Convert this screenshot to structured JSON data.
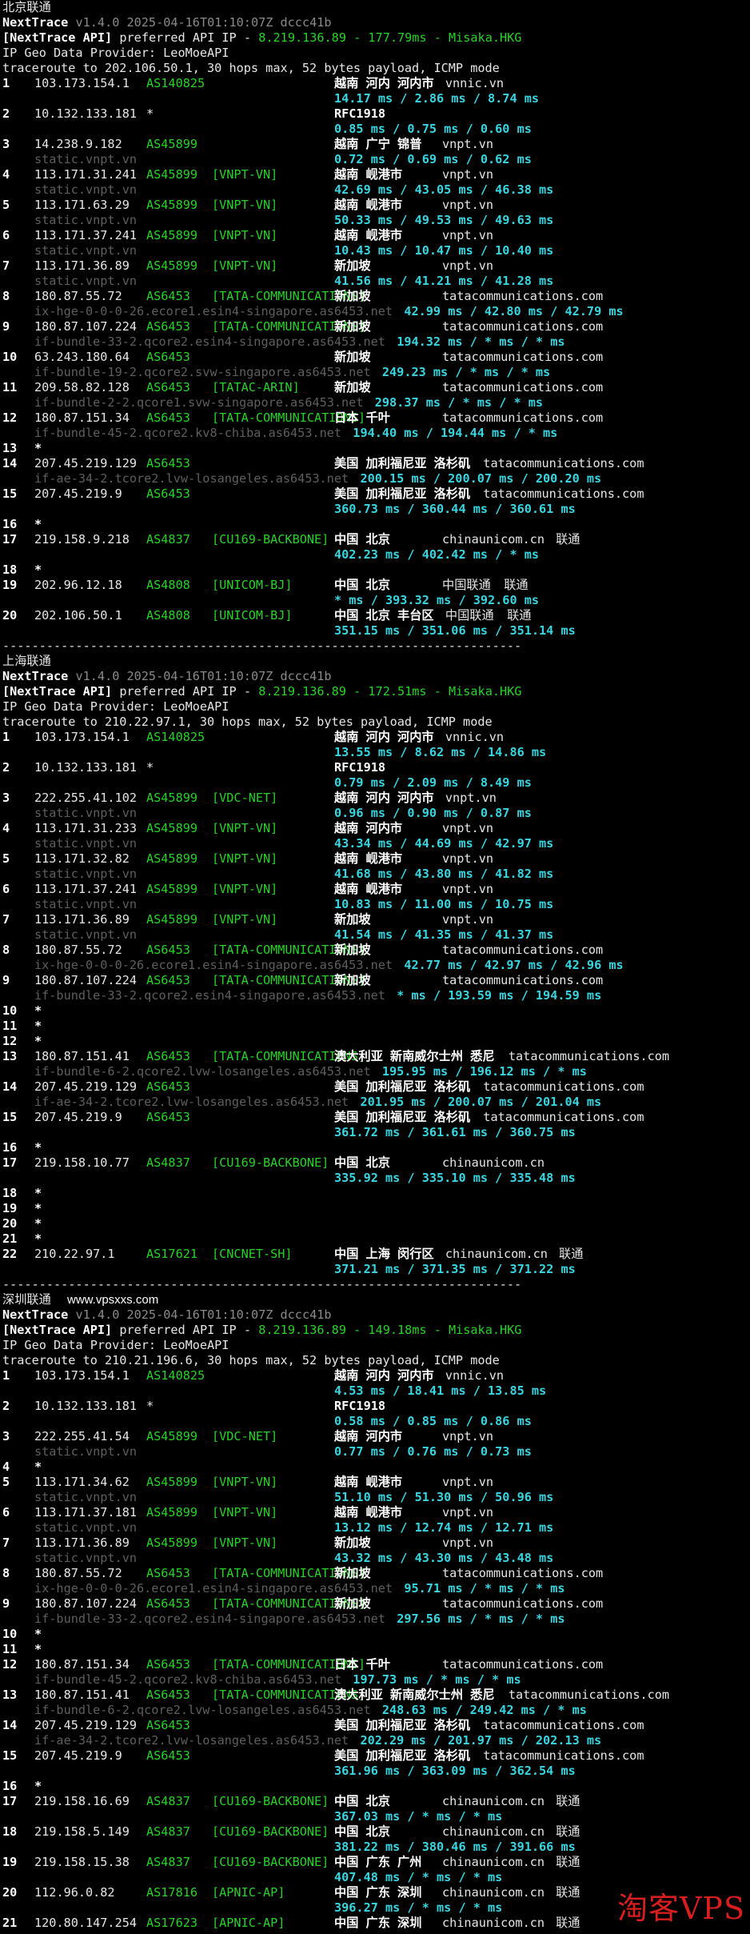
{
  "watermark": "淘客VPS",
  "site_mark": "www.vpsxxs.com",
  "lines": [
    [
      [
        "c-plain",
        "北京联通"
      ]
    ],
    [
      [
        "c-white",
        "NextTrace "
      ],
      [
        "c-gray",
        "v1.4.0 2025-04-16T01:10:07Z dccc41b"
      ]
    ],
    [
      [
        "c-white",
        "[NextTrace API] "
      ],
      [
        "c-plain",
        "preferred API IP - "
      ],
      [
        "c-green",
        "8.219.136.89 - 177.79ms - Misaka.HKG"
      ]
    ],
    [
      [
        "c-plain",
        "IP Geo Data Provider: LeoMoeAPI"
      ]
    ],
    [
      [
        "c-plain",
        "traceroute to 202.106.50.1, 30 hops max, 52 bytes payload, ICMP mode"
      ]
    ],
    {
      "hop": "1",
      "ip": "103.173.154.1",
      "asn": "AS140825",
      "tag": "",
      "geo": "越南 河内 河内市",
      "dom": "vnnic.vn",
      "carrier": ""
    },
    {
      "ms": "14.17 ms / 2.86 ms / 8.74 ms"
    },
    {
      "hop": "2",
      "ip": "10.132.133.181",
      "asn": "*",
      "tag": "",
      "geo": "RFC1918",
      "dom": "",
      "carrier": ""
    },
    {
      "ms": "0.85 ms / 0.75 ms / 0.60 ms"
    },
    {
      "hop": "3",
      "ip": "14.238.9.182",
      "asn": "AS45899",
      "tag": "",
      "geo": "越南 广宁 锦普",
      "dom": "vnpt.vn",
      "carrier": ""
    },
    {
      "rdns": "static.vnpt.vn",
      "ms": "0.72 ms / 0.69 ms / 0.62 ms"
    },
    {
      "hop": "4",
      "ip": "113.171.31.241",
      "asn": "AS45899",
      "tag": "[VNPT-VN]",
      "geo": "越南 岘港市",
      "dom": "vnpt.vn",
      "carrier": ""
    },
    {
      "rdns": "static.vnpt.vn",
      "ms": "42.69 ms / 43.05 ms / 46.38 ms"
    },
    {
      "hop": "5",
      "ip": "113.171.63.29",
      "asn": "AS45899",
      "tag": "[VNPT-VN]",
      "geo": "越南 岘港市",
      "dom": "vnpt.vn",
      "carrier": ""
    },
    {
      "rdns": "static.vnpt.vn",
      "ms": "50.33 ms / 49.53 ms / 49.63 ms"
    },
    {
      "hop": "6",
      "ip": "113.171.37.241",
      "asn": "AS45899",
      "tag": "[VNPT-VN]",
      "geo": "越南 岘港市",
      "dom": "vnpt.vn",
      "carrier": ""
    },
    {
      "rdns": "static.vnpt.vn",
      "ms": "10.43 ms / 10.47 ms / 10.40 ms"
    },
    {
      "hop": "7",
      "ip": "113.171.36.89",
      "asn": "AS45899",
      "tag": "[VNPT-VN]",
      "geo": "新加坡",
      "dom": "vnpt.vn",
      "carrier": ""
    },
    {
      "rdns": "static.vnpt.vn",
      "ms": "41.56 ms / 41.21 ms / 41.28 ms"
    },
    {
      "hop": "8",
      "ip": "180.87.55.72",
      "asn": "AS6453",
      "tag": "[TATA-COMMUNICATIONS]",
      "geo": "新加坡",
      "dom": "tatacommunications.com",
      "carrier": ""
    },
    {
      "rdns": "ix-hge-0-0-0-26.ecore1.esin4-singapore.as6453.net",
      "ms": "42.99 ms / 42.80 ms / 42.79 ms",
      "inline": true
    },
    {
      "hop": "9",
      "ip": "180.87.107.224",
      "asn": "AS6453",
      "tag": "[TATA-COMMUNICATIONS]",
      "geo": "新加坡",
      "dom": "tatacommunications.com",
      "carrier": ""
    },
    {
      "rdns": "if-bundle-33-2.qcore2.esin4-singapore.as6453.net",
      "ms": "194.32 ms / * ms / * ms",
      "inline": true
    },
    {
      "hop": "10",
      "ip": "63.243.180.64",
      "asn": "AS6453",
      "tag": "",
      "geo": "新加坡",
      "dom": "tatacommunications.com",
      "carrier": ""
    },
    {
      "rdns": "if-bundle-19-2.qcore2.svw-singapore.as6453.net",
      "ms": "249.23 ms / * ms / * ms",
      "inline": true
    },
    {
      "hop": "11",
      "ip": "209.58.82.128",
      "asn": "AS6453",
      "tag": "[TATAC-ARIN]",
      "geo": "新加坡",
      "dom": "tatacommunications.com",
      "carrier": ""
    },
    {
      "rdns": "if-bundle-2-2.qcore1.svw-singapore.as6453.net",
      "ms": "298.37 ms / * ms / * ms",
      "inline": true
    },
    {
      "hop": "12",
      "ip": "180.87.151.34",
      "asn": "AS6453",
      "tag": "[TATA-COMMUNICATIONS]",
      "geo": "日本 千叶",
      "dom": "tatacommunications.com",
      "carrier": ""
    },
    {
      "rdns": "if-bundle-45-2.qcore2.kv8-chiba.as6453.net",
      "ms": "194.40 ms / 194.44 ms / * ms",
      "inline": true
    },
    {
      "star": "13"
    },
    {
      "hop": "14",
      "ip": "207.45.219.129",
      "asn": "AS6453",
      "tag": "",
      "geo": "美国 加利福尼亚 洛杉矶",
      "dom": "tatacommunications.com",
      "carrier": ""
    },
    {
      "rdns": "if-ae-34-2.tcore2.lvw-losangeles.as6453.net",
      "ms": "200.15 ms / 200.07 ms / 200.20 ms",
      "inline": true
    },
    {
      "hop": "15",
      "ip": "207.45.219.9",
      "asn": "AS6453",
      "tag": "",
      "geo": "美国 加利福尼亚 洛杉矶",
      "dom": "tatacommunications.com",
      "carrier": ""
    },
    {
      "ms": "360.73 ms / 360.44 ms / 360.61 ms"
    },
    {
      "star": "16"
    },
    {
      "hop": "17",
      "ip": "219.158.9.218",
      "asn": "AS4837",
      "tag": "[CU169-BACKBONE]",
      "geo": "中国 北京",
      "dom": "chinaunicom.cn",
      "carrier": "联通"
    },
    {
      "ms": "402.23 ms / 402.42 ms / * ms"
    },
    {
      "star": "18"
    },
    {
      "hop": "19",
      "ip": "202.96.12.18",
      "asn": "AS4808",
      "tag": "[UNICOM-BJ]",
      "geo": "中国 北京",
      "dom": "中国联通",
      "carrier": "联通"
    },
    {
      "ms": "* ms / 393.32 ms / 392.60 ms"
    },
    {
      "hop": "20",
      "ip": "202.106.50.1",
      "asn": "AS4808",
      "tag": "[UNICOM-BJ]",
      "geo": "中国 北京 丰台区",
      "dom": "中国联通",
      "carrier": "联通"
    },
    {
      "ms": "351.15 ms / 351.06 ms / 351.14 ms"
    },
    [
      [
        "c-plain",
        "-----------------------------------------------------------------------"
      ]
    ],
    [
      [
        "c-plain",
        "上海联通"
      ]
    ],
    [
      [
        "c-white",
        "NextTrace "
      ],
      [
        "c-gray",
        "v1.4.0 2025-04-16T01:10:07Z dccc41b"
      ]
    ],
    [
      [
        "c-white",
        "[NextTrace API] "
      ],
      [
        "c-plain",
        "preferred API IP - "
      ],
      [
        "c-green",
        "8.219.136.89 - 172.51ms - Misaka.HKG"
      ]
    ],
    [
      [
        "c-plain",
        "IP Geo Data Provider: LeoMoeAPI"
      ]
    ],
    [
      [
        "c-plain",
        "traceroute to 210.22.97.1, 30 hops max, 52 bytes payload, ICMP mode"
      ]
    ],
    {
      "hop": "1",
      "ip": "103.173.154.1",
      "asn": "AS140825",
      "tag": "",
      "geo": "越南 河内 河内市",
      "dom": "vnnic.vn",
      "carrier": ""
    },
    {
      "ms": "13.55 ms / 8.62 ms / 14.86 ms"
    },
    {
      "hop": "2",
      "ip": "10.132.133.181",
      "asn": "*",
      "tag": "",
      "geo": "RFC1918",
      "dom": "",
      "carrier": ""
    },
    {
      "ms": "0.79 ms / 2.09 ms / 8.49 ms"
    },
    {
      "hop": "3",
      "ip": "222.255.41.102",
      "asn": "AS45899",
      "tag": "[VDC-NET]",
      "geo": "越南 河内 河内市",
      "dom": "vnpt.vn",
      "carrier": ""
    },
    {
      "rdns": "static.vnpt.vn",
      "ms": "0.96 ms / 0.90 ms / 0.87 ms"
    },
    {
      "hop": "4",
      "ip": "113.171.31.233",
      "asn": "AS45899",
      "tag": "[VNPT-VN]",
      "geo": "越南 河内市",
      "dom": "vnpt.vn",
      "carrier": ""
    },
    {
      "rdns": "static.vnpt.vn",
      "ms": "43.34 ms / 44.69 ms / 42.97 ms"
    },
    {
      "hop": "5",
      "ip": "113.171.32.82",
      "asn": "AS45899",
      "tag": "[VNPT-VN]",
      "geo": "越南 岘港市",
      "dom": "vnpt.vn",
      "carrier": ""
    },
    {
      "rdns": "static.vnpt.vn",
      "ms": "41.68 ms / 43.80 ms / 41.82 ms"
    },
    {
      "hop": "6",
      "ip": "113.171.37.241",
      "asn": "AS45899",
      "tag": "[VNPT-VN]",
      "geo": "越南 岘港市",
      "dom": "vnpt.vn",
      "carrier": ""
    },
    {
      "rdns": "static.vnpt.vn",
      "ms": "10.83 ms / 11.00 ms / 10.75 ms"
    },
    {
      "hop": "7",
      "ip": "113.171.36.89",
      "asn": "AS45899",
      "tag": "[VNPT-VN]",
      "geo": "新加坡",
      "dom": "vnpt.vn",
      "carrier": ""
    },
    {
      "rdns": "static.vnpt.vn",
      "ms": "41.54 ms / 41.35 ms / 41.37 ms"
    },
    {
      "hop": "8",
      "ip": "180.87.55.72",
      "asn": "AS6453",
      "tag": "[TATA-COMMUNICATIONS]",
      "geo": "新加坡",
      "dom": "tatacommunications.com",
      "carrier": ""
    },
    {
      "rdns": "ix-hge-0-0-0-26.ecore1.esin4-singapore.as6453.net",
      "ms": "42.77 ms / 42.97 ms / 42.96 ms",
      "inline": true
    },
    {
      "hop": "9",
      "ip": "180.87.107.224",
      "asn": "AS6453",
      "tag": "[TATA-COMMUNICATIONS]",
      "geo": "新加坡",
      "dom": "tatacommunications.com",
      "carrier": ""
    },
    {
      "rdns": "if-bundle-33-2.qcore2.esin4-singapore.as6453.net",
      "ms": "* ms / 193.59 ms / 194.59 ms",
      "inline": true
    },
    {
      "star": "10"
    },
    {
      "star": "11"
    },
    {
      "star": "12"
    },
    {
      "hop": "13",
      "ip": "180.87.151.41",
      "asn": "AS6453",
      "tag": "[TATA-COMMUNICATIONS]",
      "geo": "澳大利亚 新南威尔士州 悉尼",
      "dom": "tatacommunications.com",
      "carrier": ""
    },
    {
      "rdns": "if-bundle-6-2.qcore2.lvw-losangeles.as6453.net",
      "ms": "195.95 ms / 196.12 ms / * ms",
      "inline": true
    },
    {
      "hop": "14",
      "ip": "207.45.219.129",
      "asn": "AS6453",
      "tag": "",
      "geo": "美国 加利福尼亚 洛杉矶",
      "dom": "tatacommunications.com",
      "carrier": ""
    },
    {
      "rdns": "if-ae-34-2.tcore2.lvw-losangeles.as6453.net",
      "ms": "201.95 ms / 200.07 ms / 201.04 ms",
      "inline": true
    },
    {
      "hop": "15",
      "ip": "207.45.219.9",
      "asn": "AS6453",
      "tag": "",
      "geo": "美国 加利福尼亚 洛杉矶",
      "dom": "tatacommunications.com",
      "carrier": ""
    },
    {
      "ms": "361.72 ms / 361.61 ms / 360.75 ms"
    },
    {
      "star": "16"
    },
    {
      "hop": "17",
      "ip": "219.158.10.77",
      "asn": "AS4837",
      "tag": "[CU169-BACKBONE]",
      "geo": "中国 北京",
      "dom": "chinaunicom.cn",
      "carrier": ""
    },
    {
      "ms": "335.92 ms / 335.10 ms / 335.48 ms"
    },
    {
      "star": "18"
    },
    {
      "star": "19"
    },
    {
      "star": "20"
    },
    {
      "star": "21"
    },
    {
      "hop": "22",
      "ip": "210.22.97.1",
      "asn": "AS17621",
      "tag": "[CNCNET-SH]",
      "geo": "中国 上海 闵行区",
      "dom": "chinaunicom.cn",
      "carrier": "联通"
    },
    {
      "ms": "371.21 ms / 371.35 ms / 371.22 ms"
    },
    [
      [
        "c-plain",
        "-----------------------------------------------------------------------"
      ]
    ],
    [
      [
        "c-plain",
        "深圳联通"
      ]
    ],
    [
      [
        "c-white",
        "NextTrace "
      ],
      [
        "c-gray",
        "v1.4.0 2025-04-16T01:10:07Z dccc41b"
      ]
    ],
    [
      [
        "c-white",
        "[NextTrace API] "
      ],
      [
        "c-plain",
        "preferred API IP - "
      ],
      [
        "c-green",
        "8.219.136.89 - 149.18ms - Misaka.HKG"
      ]
    ],
    [
      [
        "c-plain",
        "IP Geo Data Provider: LeoMoeAPI"
      ]
    ],
    [
      [
        "c-plain",
        "traceroute to 210.21.196.6, 30 hops max, 52 bytes payload, ICMP mode"
      ]
    ],
    {
      "hop": "1",
      "ip": "103.173.154.1",
      "asn": "AS140825",
      "tag": "",
      "geo": "越南 河内 河内市",
      "dom": "vnnic.vn",
      "carrier": ""
    },
    {
      "ms": "4.53 ms / 18.41 ms / 13.85 ms"
    },
    {
      "hop": "2",
      "ip": "10.132.133.181",
      "asn": "*",
      "tag": "",
      "geo": "RFC1918",
      "dom": "",
      "carrier": ""
    },
    {
      "ms": "0.58 ms / 0.85 ms / 0.86 ms"
    },
    {
      "hop": "3",
      "ip": "222.255.41.54",
      "asn": "AS45899",
      "tag": "[VDC-NET]",
      "geo": "越南 河内市",
      "dom": "vnpt.vn",
      "carrier": ""
    },
    {
      "rdns": "static.vnpt.vn",
      "ms": "0.77 ms / 0.76 ms / 0.73 ms"
    },
    {
      "star": "4"
    },
    {
      "hop": "5",
      "ip": "113.171.34.62",
      "asn": "AS45899",
      "tag": "[VNPT-VN]",
      "geo": "越南 岘港市",
      "dom": "vnpt.vn",
      "carrier": ""
    },
    {
      "rdns": "static.vnpt.vn",
      "ms": "51.10 ms / 51.30 ms / 50.96 ms"
    },
    {
      "hop": "6",
      "ip": "113.171.37.181",
      "asn": "AS45899",
      "tag": "[VNPT-VN]",
      "geo": "越南 岘港市",
      "dom": "vnpt.vn",
      "carrier": ""
    },
    {
      "rdns": "static.vnpt.vn",
      "ms": "13.12 ms / 12.74 ms / 12.71 ms"
    },
    {
      "hop": "7",
      "ip": "113.171.36.89",
      "asn": "AS45899",
      "tag": "[VNPT-VN]",
      "geo": "新加坡",
      "dom": "vnpt.vn",
      "carrier": ""
    },
    {
      "rdns": "static.vnpt.vn",
      "ms": "43.32 ms / 43.30 ms / 43.48 ms"
    },
    {
      "hop": "8",
      "ip": "180.87.55.72",
      "asn": "AS6453",
      "tag": "[TATA-COMMUNICATIONS]",
      "geo": "新加坡",
      "dom": "tatacommunications.com",
      "carrier": ""
    },
    {
      "rdns": "ix-hge-0-0-0-26.ecore1.esin4-singapore.as6453.net",
      "ms": "95.71 ms / * ms / * ms",
      "inline": true
    },
    {
      "hop": "9",
      "ip": "180.87.107.224",
      "asn": "AS6453",
      "tag": "[TATA-COMMUNICATIONS]",
      "geo": "新加坡",
      "dom": "tatacommunications.com",
      "carrier": ""
    },
    {
      "rdns": "if-bundle-33-2.qcore2.esin4-singapore.as6453.net",
      "ms": "297.56 ms / * ms / * ms",
      "inline": true
    },
    {
      "star": "10"
    },
    {
      "star": "11"
    },
    {
      "hop": "12",
      "ip": "180.87.151.34",
      "asn": "AS6453",
      "tag": "[TATA-COMMUNICATIONS]",
      "geo": "日本 千叶",
      "dom": "tatacommunications.com",
      "carrier": ""
    },
    {
      "rdns": "if-bundle-45-2.qcore2.kv8-chiba.as6453.net",
      "ms": "197.73 ms / * ms / * ms",
      "inline": true
    },
    {
      "hop": "13",
      "ip": "180.87.151.41",
      "asn": "AS6453",
      "tag": "[TATA-COMMUNICATIONS]",
      "geo": "澳大利亚 新南威尔士州 悉尼",
      "dom": "tatacommunications.com",
      "carrier": ""
    },
    {
      "rdns": "if-bundle-6-2.qcore2.lvw-losangeles.as6453.net",
      "ms": "248.63 ms / 249.42 ms / * ms",
      "inline": true
    },
    {
      "hop": "14",
      "ip": "207.45.219.129",
      "asn": "AS6453",
      "tag": "",
      "geo": "美国 加利福尼亚 洛杉矶",
      "dom": "tatacommunications.com",
      "carrier": ""
    },
    {
      "rdns": "if-ae-34-2.tcore2.lvw-losangeles.as6453.net",
      "ms": "202.29 ms / 201.97 ms / 202.13 ms",
      "inline": true
    },
    {
      "hop": "15",
      "ip": "207.45.219.9",
      "asn": "AS6453",
      "tag": "",
      "geo": "美国 加利福尼亚 洛杉矶",
      "dom": "tatacommunications.com",
      "carrier": ""
    },
    {
      "ms": "361.96 ms / 363.09 ms / 362.54 ms"
    },
    {
      "star": "16"
    },
    {
      "hop": "17",
      "ip": "219.158.16.69",
      "asn": "AS4837",
      "tag": "[CU169-BACKBONE]",
      "geo": "中国 北京",
      "dom": "chinaunicom.cn",
      "carrier": "联通"
    },
    {
      "ms": "367.03 ms / * ms / * ms"
    },
    {
      "hop": "18",
      "ip": "219.158.5.149",
      "asn": "AS4837",
      "tag": "[CU169-BACKBONE]",
      "geo": "中国 北京",
      "dom": "chinaunicom.cn",
      "carrier": "联通"
    },
    {
      "ms": "381.22 ms / 380.46 ms / 391.66 ms"
    },
    {
      "hop": "19",
      "ip": "219.158.15.38",
      "asn": "AS4837",
      "tag": "[CU169-BACKBONE]",
      "geo": "中国 广东 广州",
      "dom": "chinaunicom.cn",
      "carrier": "联通"
    },
    {
      "ms": "407.48 ms / * ms / * ms"
    },
    {
      "hop": "20",
      "ip": "112.96.0.82",
      "asn": "AS17816",
      "tag": "[APNIC-AP]",
      "geo": "中国 广东 深圳",
      "dom": "chinaunicom.cn",
      "carrier": "联通"
    },
    {
      "ms": "396.27 ms / * ms / * ms"
    },
    {
      "hop": "21",
      "ip": "120.80.147.254",
      "asn": "AS17623",
      "tag": "[APNIC-AP]",
      "geo": "中国 广东 深圳",
      "dom": "chinaunicom.cn",
      "carrier": "联通"
    }
  ]
}
